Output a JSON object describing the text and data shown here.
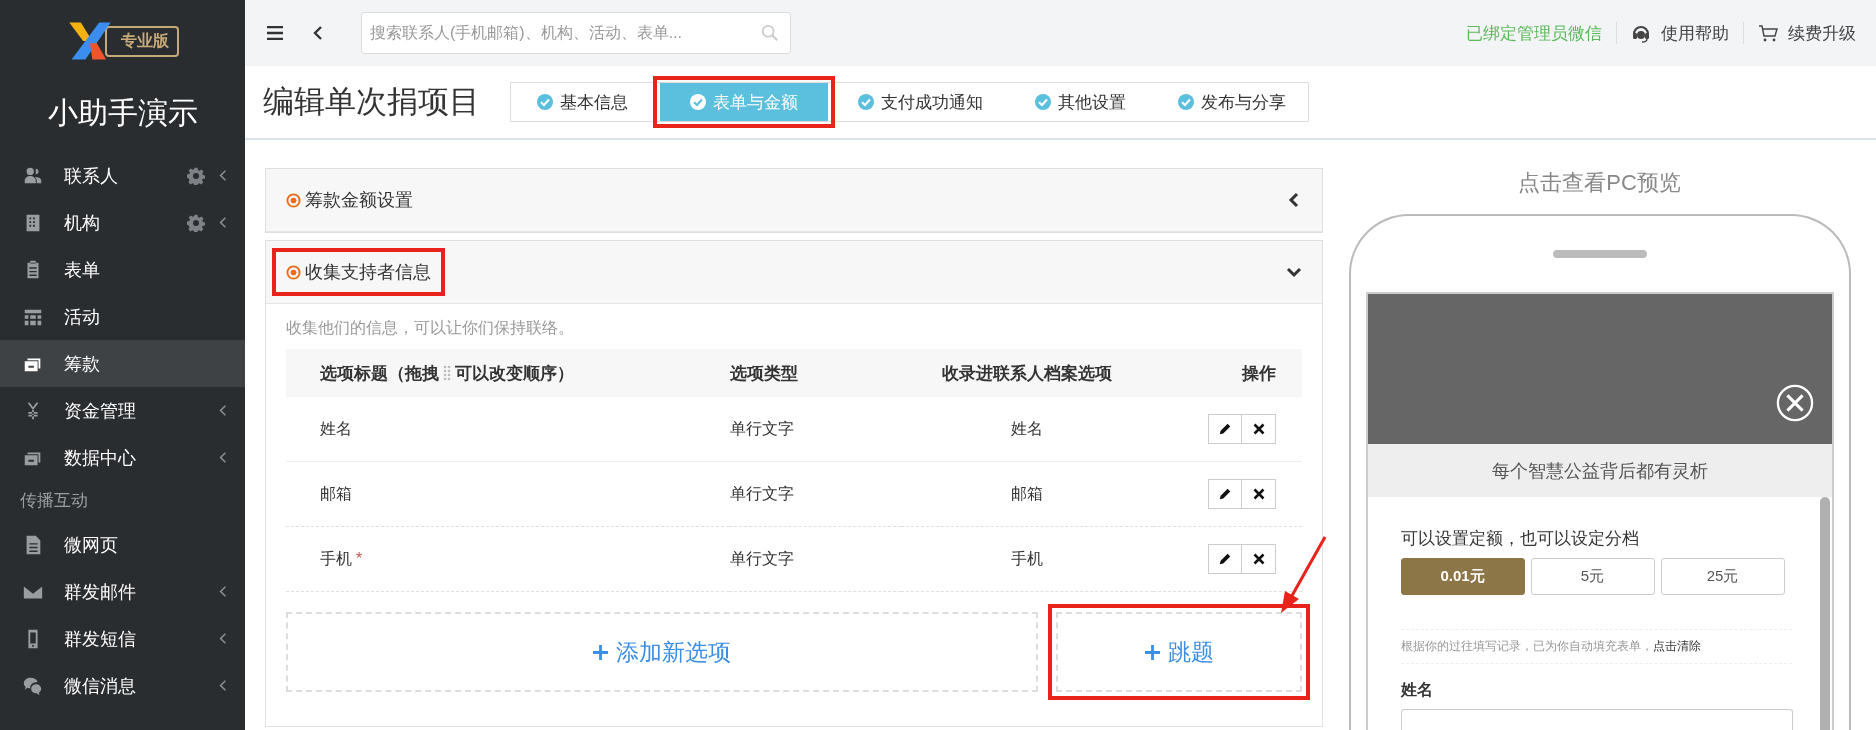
{
  "sidebar": {
    "logo_badge": "专业版",
    "title": "小助手演示",
    "items": [
      {
        "kind": "item",
        "label": "联系人",
        "selected": false,
        "settings": true,
        "expandable": true
      },
      {
        "kind": "item",
        "label": "机构",
        "selected": false,
        "settings": true,
        "expandable": true
      },
      {
        "kind": "item",
        "label": "表单",
        "selected": false,
        "settings": false,
        "expandable": false
      },
      {
        "kind": "item",
        "label": "活动",
        "selected": false,
        "settings": false,
        "expandable": false
      },
      {
        "kind": "item",
        "label": "筹款",
        "selected": true,
        "settings": false,
        "expandable": false
      },
      {
        "kind": "item",
        "label": "资金管理",
        "selected": false,
        "settings": false,
        "expandable": true
      },
      {
        "kind": "item",
        "label": "数据中心",
        "selected": false,
        "settings": false,
        "expandable": true
      },
      {
        "kind": "heading",
        "label": "传播互动"
      },
      {
        "kind": "item",
        "label": "微网页",
        "selected": false,
        "settings": false,
        "expandable": false
      },
      {
        "kind": "item",
        "label": "群发邮件",
        "selected": false,
        "settings": false,
        "expandable": true
      },
      {
        "kind": "item",
        "label": "群发短信",
        "selected": false,
        "settings": false,
        "expandable": true
      },
      {
        "kind": "item",
        "label": "微信消息",
        "selected": false,
        "settings": false,
        "expandable": true
      }
    ]
  },
  "topbar": {
    "search": {
      "placeholder": "搜索联系人(手机邮箱)、机构、活动、表单..."
    },
    "wechat_status": "已绑定管理员微信",
    "help": "使用帮助",
    "upgrade": "续费升级"
  },
  "page_title": "编辑单次捐项目",
  "steps": [
    {
      "label": "基本信息",
      "selected": false,
      "annotated": false
    },
    {
      "label": "表单与金额",
      "selected": true,
      "annotated": true
    },
    {
      "label": "支付成功通知",
      "selected": false,
      "annotated": false
    },
    {
      "label": "其他设置",
      "selected": false,
      "annotated": false
    },
    {
      "label": "发布与分享",
      "selected": false,
      "annotated": false
    }
  ],
  "sections": [
    {
      "title": "筹款金额设置",
      "expanded": false,
      "annotated": false
    },
    {
      "title": "收集支持者信息",
      "expanded": true,
      "annotated": true,
      "description": "收集他们的信息，可以让你们保持联络。",
      "columns": [
        {
          "label": "选项标题（拖拽",
          "label_after": "可以改变顺序）"
        },
        {
          "label": "选项类型"
        },
        {
          "label": "收录进联系人档案选项"
        },
        {
          "label": "操作"
        }
      ],
      "rows": [
        {
          "title": "姓名",
          "type": "单行文字",
          "field": "姓名"
        },
        {
          "title": "邮箱",
          "type": "单行文字",
          "field": "邮箱"
        },
        {
          "title": "手机",
          "required_mark": "*",
          "type": "单行文字",
          "field": "手机"
        }
      ],
      "buttons": [
        {
          "label": "添加新选项",
          "annotated": false
        },
        {
          "label": "跳题",
          "annotated": true
        }
      ]
    }
  ],
  "preview": {
    "title": "点击查看PC预览",
    "banner_text": "每个智慧公益背后都有灵析",
    "amount_prompt": "可以设置定额，也可以设定分档",
    "amounts": [
      {
        "label": "0.01元",
        "selected": true
      },
      {
        "label": "5元",
        "selected": false
      },
      {
        "label": "25元",
        "selected": false
      }
    ],
    "autofill_note": "根据你的过往填写记录，已为你自动填充表单，",
    "autofill_link": "点击清除",
    "field_label": "姓名"
  }
}
